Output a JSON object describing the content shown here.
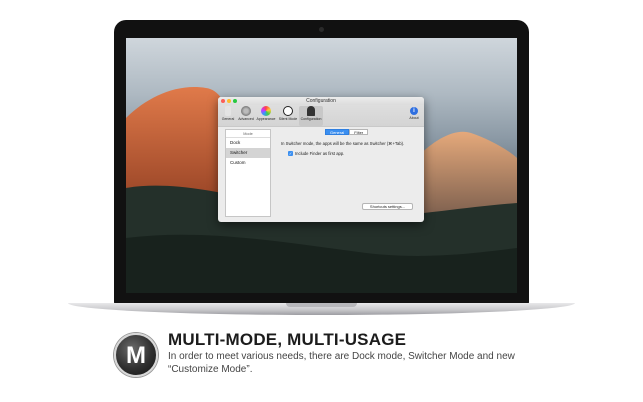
{
  "window": {
    "title": "Configuration",
    "toolbar": [
      {
        "label": "General",
        "icon": "phone-icon",
        "color": "#b9b9b9"
      },
      {
        "label": "Advanced",
        "icon": "gear-icon",
        "color": "#8d8d8d"
      },
      {
        "label": "Appearance",
        "icon": "color-wheel-icon",
        "color": "#f2a93b"
      },
      {
        "label": "Silent Mode",
        "icon": "silent-mode-icon",
        "color": "#222222"
      },
      {
        "label": "Configuration",
        "icon": "person-icon",
        "color": "#333333"
      },
      {
        "label": "About",
        "icon": "info-icon",
        "color": "#2f6fe0"
      }
    ],
    "sidebar": {
      "header": "Mode",
      "items": [
        "Dock",
        "Switcher",
        "Custom"
      ],
      "selected": "Switcher"
    },
    "tabs": [
      "General",
      "Filter"
    ],
    "active_tab": "General",
    "description": "In Switcher mode, the apps will be the same as Switcher (⌘+Tab).",
    "checkbox_label": "Include Finder as first app.",
    "checkbox_checked": true,
    "shortcut_button": "Shortcuts settings..."
  },
  "caption": {
    "logo_letter": "M",
    "headline": "MULTI-MODE, MULTI-USAGE",
    "subtext": "In order to meet various needs, there are Dock mode, Switcher Mode and new “Customize Mode”."
  },
  "colors": {
    "accent": "#3b8ff0"
  }
}
